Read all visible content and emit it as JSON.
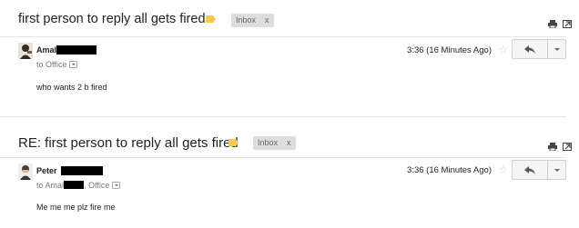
{
  "threads": [
    {
      "subject": "first person to reply all gets fired",
      "inbox_label": "Inbox",
      "inbox_close": "x",
      "label_color": "#f7c948",
      "icons": [
        "print-icon",
        "new-window-icon"
      ],
      "message": {
        "sender_name": "Amal",
        "to_prefix": "to Office",
        "timestamp": "3:36 (16 Minutes Ago)",
        "body": "who wants 2 b fired"
      }
    },
    {
      "subject": "RE: first person to reply all gets fired",
      "inbox_label": "Inbox",
      "inbox_close": "x",
      "label_color": "#f7c948",
      "icons": [
        "print-icon",
        "new-window-icon"
      ],
      "message": {
        "sender_name": "Peter",
        "to_prefix": "to Amal",
        "to_suffix": ", Office",
        "timestamp": "3:36 (16 Minutes Ago)",
        "body": "Me me me plz fire me"
      }
    }
  ],
  "colors": {
    "label_tag": "#f7c948",
    "chip_bg": "#dddddd",
    "star": "#d0d0d0"
  }
}
